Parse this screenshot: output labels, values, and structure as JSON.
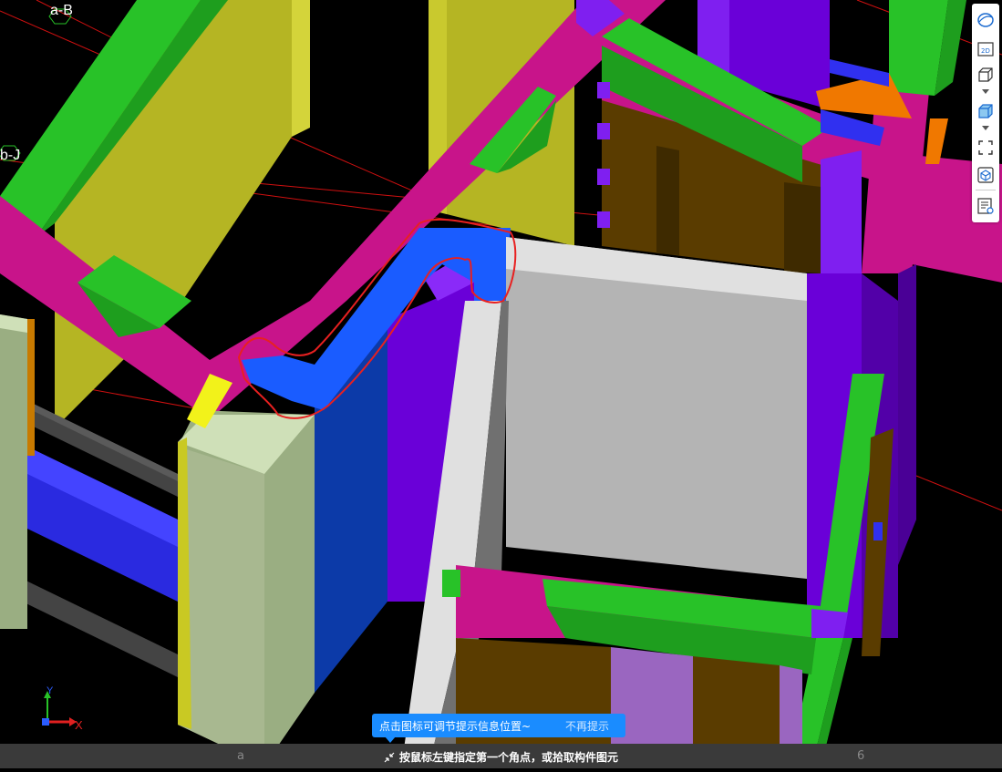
{
  "scene": {
    "grid_labels": [
      "a-B",
      "b-J"
    ],
    "bottom_ghost_labels": [
      "a",
      "6"
    ],
    "colors": {
      "background": "#000000",
      "grid_line": "#d01010",
      "beam_magenta": "#c8148a",
      "beam_green": "#28c228",
      "wall_yellow": "#b5b523",
      "column_purple": "#6a00d8",
      "highlight_blue": "#1a5cff",
      "slab_gray": "#bdbdbd",
      "column_beige": "#cfe0b8",
      "brown": "#5a3c00",
      "orange": "#f07800",
      "selection_outline": "#e82020"
    }
  },
  "axis_triad": {
    "x_label": "X",
    "y_label": "Y"
  },
  "toolbar": {
    "items": [
      {
        "name": "dynamic-observe-icon"
      },
      {
        "name": "2d-view-icon",
        "text": "2D"
      },
      {
        "name": "3d-view-icon"
      },
      {
        "name": "shaded-view-icon"
      },
      {
        "name": "fullscreen-icon"
      },
      {
        "name": "component-view-icon"
      },
      {
        "name": "display-settings-icon"
      }
    ]
  },
  "tip": {
    "message": "点击图标可调节提示信息位置~",
    "dismiss": "不再提示"
  },
  "status_bar": {
    "prompt": "按鼠标左键指定第一个角点，或拾取构件图元"
  }
}
